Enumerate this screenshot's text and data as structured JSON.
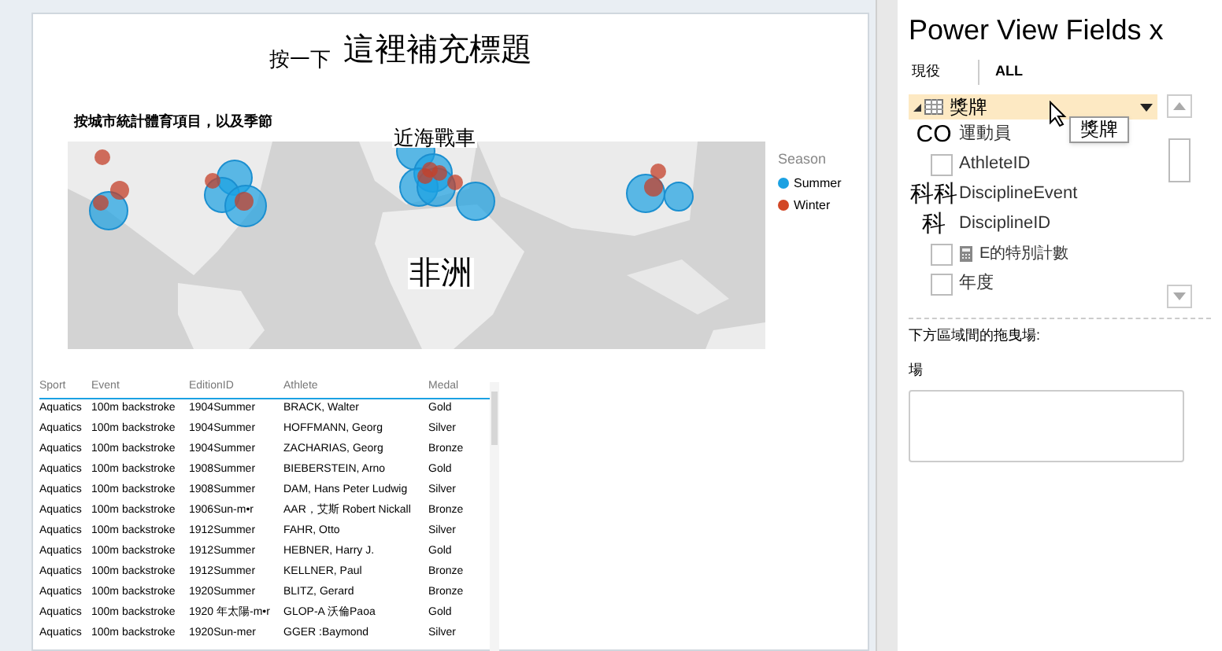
{
  "report": {
    "title_prefix": "按一下",
    "title": "這裡補充標題",
    "map": {
      "title": "按城市統計體育項目，以及季節",
      "overlay_labels": [
        "近海戰車",
        "非洲"
      ],
      "legend": {
        "title": "Season",
        "items": [
          {
            "label": "Summer",
            "color": "#1ba1e2"
          },
          {
            "label": "Winter",
            "color": "#d24726"
          }
        ]
      }
    },
    "table": {
      "columns": [
        "Sport",
        "Event",
        "EditionID",
        "Athlete",
        "Medal"
      ],
      "rows": [
        [
          "Aquatics",
          "100m backstroke",
          "1904Summer",
          "BRACK, Walter",
          "Gold"
        ],
        [
          "Aquatics",
          "100m backstroke",
          "1904Summer",
          "HOFFMANN, Georg",
          "Silver"
        ],
        [
          "Aquatics",
          "100m backstroke",
          "1904Summer",
          "ZACHARIAS, Georg",
          "Bronze"
        ],
        [
          "Aquatics",
          "100m backstroke",
          "1908Summer",
          "BIEBERSTEIN, Arno",
          "Gold"
        ],
        [
          "Aquatics",
          "100m backstroke",
          "1908Summer",
          "DAM, Hans Peter Ludwig",
          "Silver"
        ],
        [
          "Aquatics",
          "100m backstroke",
          "1906Sun-m•r",
          "AAR，艾斯 Robert Nickall",
          "Bronze"
        ],
        [
          "Aquatics",
          "100m backstroke",
          "1912Summer",
          "FAHR, Otto",
          "Silver"
        ],
        [
          "Aquatics",
          "100m backstroke",
          "1912Summer",
          "HEBNER, Harry J.",
          "Gold"
        ],
        [
          "Aquatics",
          "100m backstroke",
          "1912Summer",
          "KELLNER, Paul",
          "Bronze"
        ],
        [
          "Aquatics",
          "100m backstroke",
          "1920Summer",
          "BLITZ, Gerard",
          "Bronze"
        ],
        [
          "Aquatics",
          "100m backstroke",
          "1920 年太陽-m•r",
          "GLOP-A 沃倫Paoa",
          "Gold"
        ],
        [
          "Aquatics",
          "100m backstroke",
          "1920Sun-mer",
          "GGER :Baymond",
          "Silver"
        ]
      ]
    }
  },
  "fields_pane": {
    "title": "Power View Fields x",
    "tabs": [
      {
        "label": "現役",
        "selected": false
      },
      {
        "label": "ALL",
        "selected": true
      }
    ],
    "table_name": "獎牌",
    "tooltip": "獎牌",
    "fields": [
      {
        "kind": "marker",
        "marker": "CO",
        "label": "運動員"
      },
      {
        "kind": "checkbox",
        "label": "AthleteID",
        "checked": false
      },
      {
        "kind": "marker",
        "marker": "科科",
        "label": "DisciplineEvent"
      },
      {
        "kind": "marker",
        "marker": "科",
        "label": "DisciplineID"
      },
      {
        "kind": "calculated",
        "label": "E的特別計數",
        "checked": false
      },
      {
        "kind": "checkbox",
        "label": "年度",
        "checked": false
      }
    ],
    "drag_hint": "下方區域間的拖曳場:",
    "zone_label": "場"
  }
}
